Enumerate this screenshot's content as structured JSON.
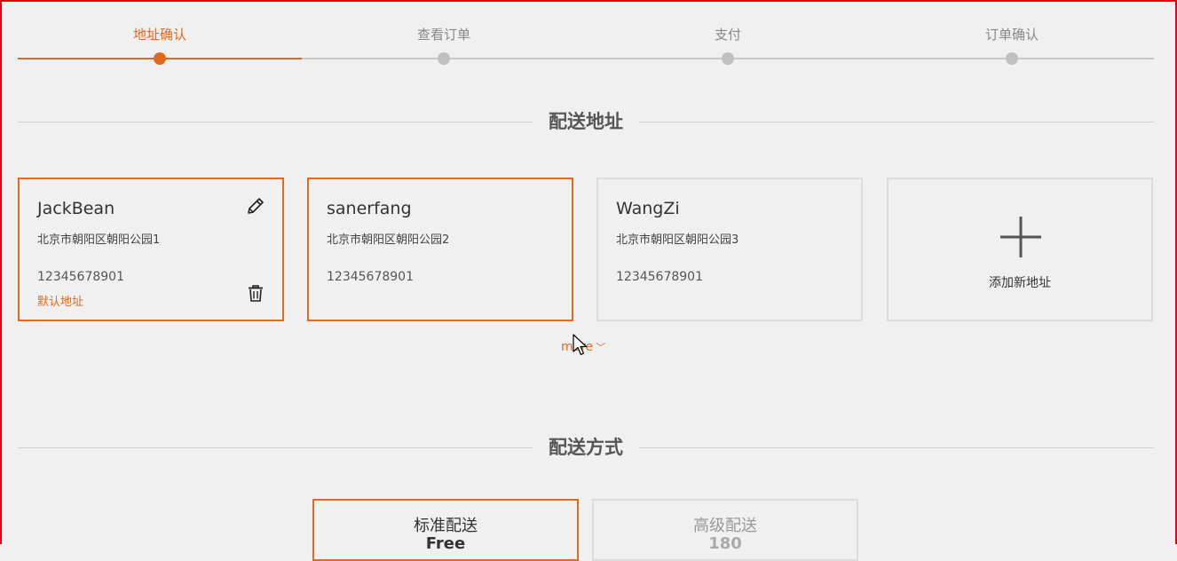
{
  "steps": [
    {
      "label": "地址确认",
      "active": true
    },
    {
      "label": "查看订单",
      "active": false
    },
    {
      "label": "支付",
      "active": false
    },
    {
      "label": "订单确认",
      "active": false
    }
  ],
  "address_section": {
    "title": "配送地址",
    "cards": [
      {
        "name": "JackBean",
        "street": "北京市朝阳区朝阳公园1",
        "phone": "12345678901",
        "default_label": "默认地址",
        "selected": true
      },
      {
        "name": "sanerfang",
        "street": "北京市朝阳区朝阳公园2",
        "phone": "12345678901",
        "selected": true
      },
      {
        "name": "WangZi",
        "street": "北京市朝阳区朝阳公园3",
        "phone": "12345678901",
        "selected": false
      }
    ],
    "add_label": "添加新地址",
    "more_label": "more",
    "more_icon": "chevron-down-icon"
  },
  "shipping_section": {
    "title": "配送方式",
    "options": [
      {
        "name": "标准配送",
        "price": "Free",
        "selected": true
      },
      {
        "name": "高级配送",
        "price": "180",
        "selected": false
      }
    ]
  },
  "colors": {
    "accent": "#e0691f",
    "inactive": "#c0c0c0",
    "background": "#f0f0f0"
  }
}
